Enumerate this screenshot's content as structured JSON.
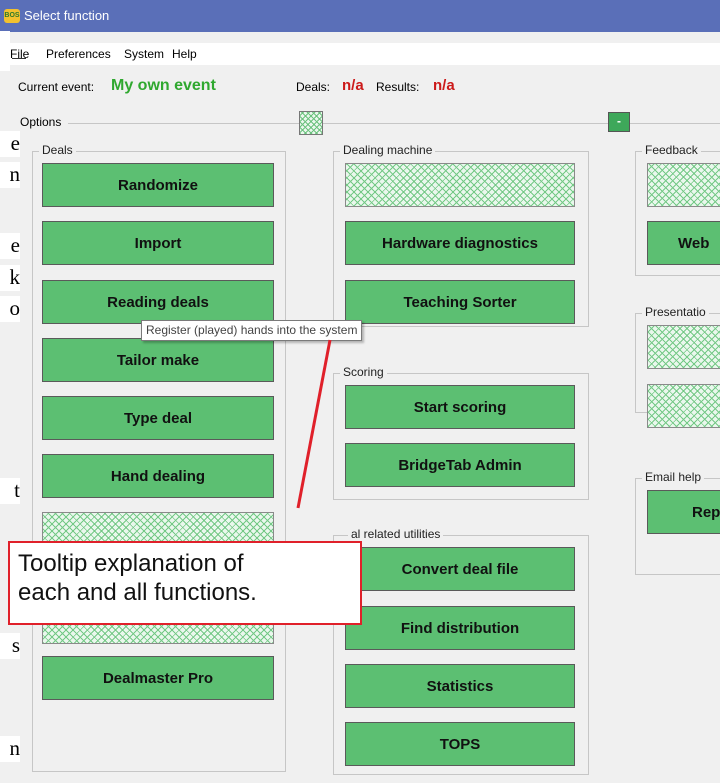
{
  "window": {
    "title": "Select function",
    "icon": "app-icon"
  },
  "menu": {
    "items": [
      "File",
      "Preferences",
      "System",
      "Help"
    ]
  },
  "info": {
    "current_event_label": "Current event:",
    "current_event_value": "My own event",
    "deals_label": "Deals:",
    "deals_value": "n/a",
    "results_label": "Results:",
    "results_value": "n/a"
  },
  "options": {
    "label": "Options",
    "collapse_label": "-"
  },
  "deals_group": {
    "label": "Deals",
    "buttons": [
      "Randomize",
      "Import",
      "Reading deals",
      "Tailor make",
      "Type deal",
      "Hand dealing",
      "",
      "Dealmaster Pro"
    ]
  },
  "dealing_machine_group": {
    "label": "Dealing machine",
    "buttons": [
      "",
      "Hardware diagnostics",
      "Teaching Sorter"
    ]
  },
  "scoring_group": {
    "label": "Scoring",
    "buttons": [
      "Start scoring",
      "BridgeTab Admin"
    ]
  },
  "deal_utilities_group": {
    "label": "al related utilities",
    "buttons": [
      "Convert deal file",
      "Find distribution",
      "Statistics",
      "TOPS"
    ]
  },
  "feedback_group": {
    "label": "Feedback",
    "buttons": [
      "",
      "Web"
    ]
  },
  "presentation_group": {
    "label": "Presentatio",
    "buttons": [
      "",
      ""
    ]
  },
  "email_group": {
    "label": "Email help",
    "buttons": [
      "Rep"
    ]
  },
  "tooltip": {
    "text": "Register (played) hands into the system"
  },
  "callout": {
    "line1": "Tooltip explanation of",
    "line2": "each and all functions."
  },
  "page_fragments": [
    "e",
    "n",
    "e",
    "k",
    "o",
    "t",
    "s",
    "n"
  ],
  "colors": {
    "titlebar": "#5a6fb8",
    "button_green": "#5cbf72",
    "event_green": "#2fa82f",
    "value_red": "#cc1a1a",
    "callout_red": "#e0202a"
  }
}
